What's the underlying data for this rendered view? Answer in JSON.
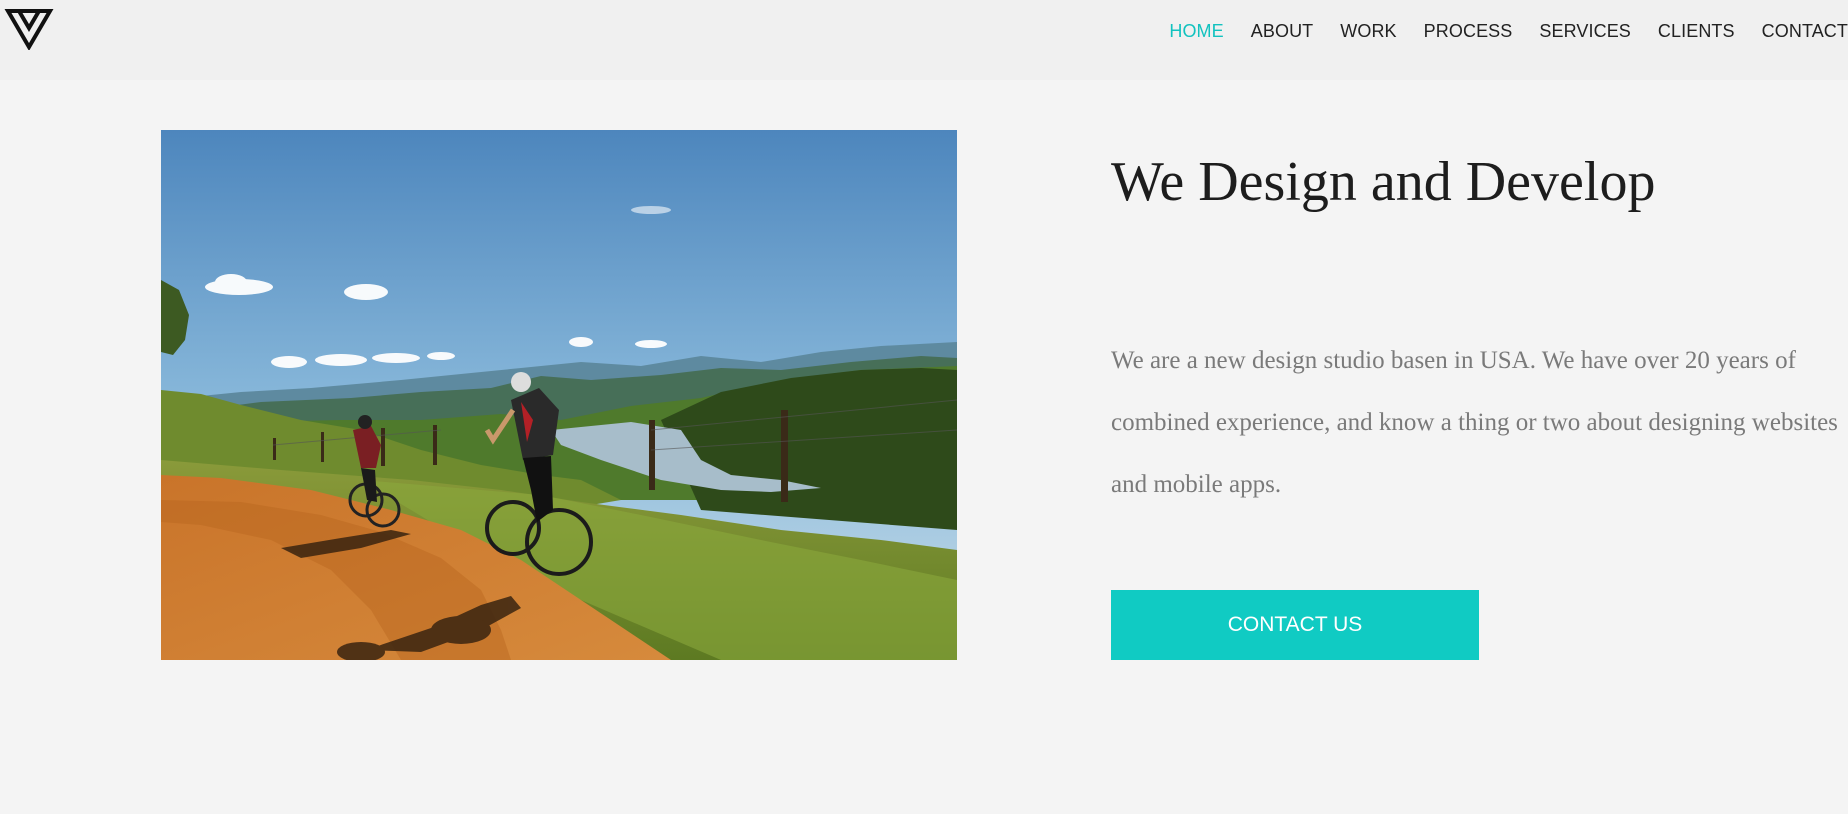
{
  "nav": {
    "items": [
      {
        "label": "HOME",
        "active": true
      },
      {
        "label": "ABOUT",
        "active": false
      },
      {
        "label": "WORK",
        "active": false
      },
      {
        "label": "PROCESS",
        "active": false
      },
      {
        "label": "SERVICES",
        "active": false
      },
      {
        "label": "CLIENTS",
        "active": false
      },
      {
        "label": "CONTACT",
        "active": false
      }
    ]
  },
  "logo": {
    "icon": "triangle-logo-icon"
  },
  "hero": {
    "image_icon": "mountain-bikers-photo",
    "title": "We Design and Develop",
    "description": "We are a new design studio basen in USA. We have over 20 years of combined experience, and know a thing or two about designing websites and mobile apps.",
    "cta_label": "CONTACT US"
  },
  "colors": {
    "accent": "#12c2bf",
    "button": "#10cbc3",
    "background": "#f4f4f4",
    "header": "#f0f0f0",
    "title": "#1d1d1d",
    "body_text": "#7a7a7a"
  }
}
